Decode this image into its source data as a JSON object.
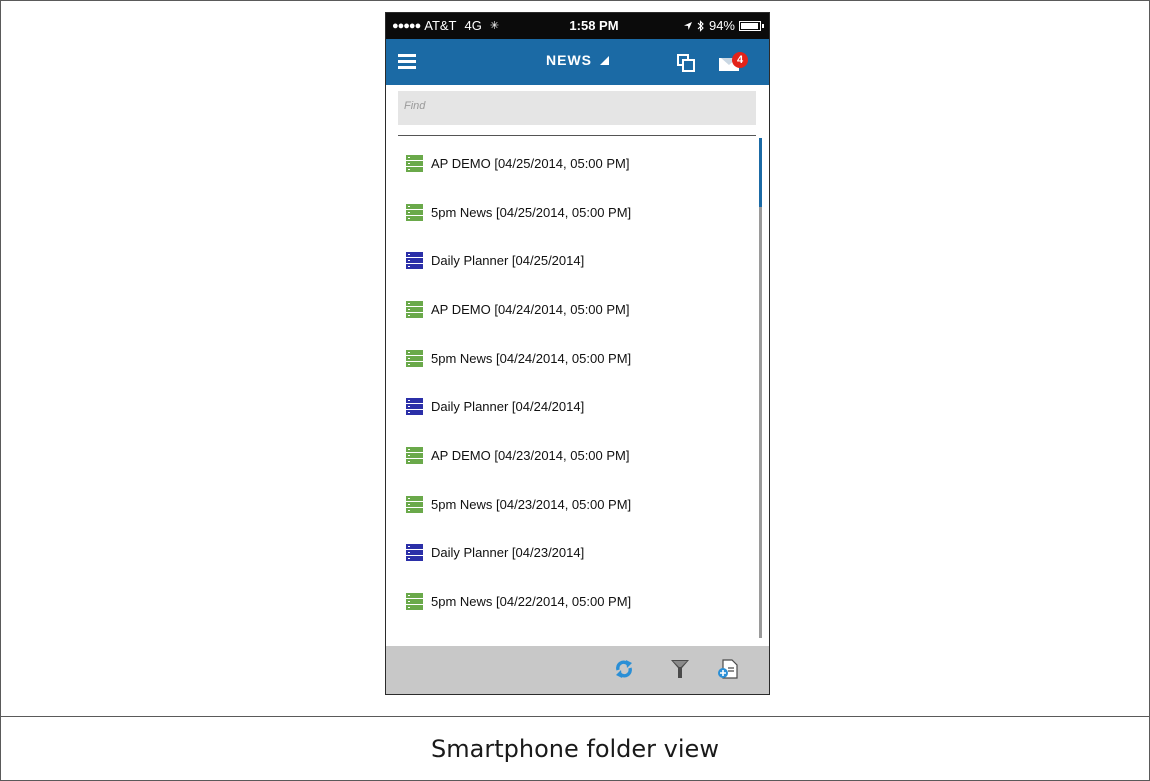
{
  "caption": "Smartphone folder view",
  "status_bar": {
    "signal_dots": "●●●●●",
    "carrier": "AT&T",
    "network": "4G",
    "time": "1:58 PM",
    "battery": "94%"
  },
  "nav": {
    "title": "NEWS",
    "mail_badge_count": "4"
  },
  "search": {
    "placeholder": "Find"
  },
  "items": [
    {
      "label": "AP DEMO [04/25/2014, 05:00 PM]",
      "icon": "green-rundown-icon"
    },
    {
      "label": "5pm News [04/25/2014, 05:00 PM]",
      "icon": "green-rundown-icon"
    },
    {
      "label": "Daily Planner [04/25/2014]",
      "icon": "blue-planner-icon"
    },
    {
      "label": "AP DEMO [04/24/2014, 05:00 PM]",
      "icon": "green-rundown-icon"
    },
    {
      "label": "5pm News [04/24/2014, 05:00 PM]",
      "icon": "green-rundown-icon"
    },
    {
      "label": "Daily Planner [04/24/2014]",
      "icon": "blue-planner-icon"
    },
    {
      "label": "AP DEMO [04/23/2014, 05:00 PM]",
      "icon": "green-rundown-icon"
    },
    {
      "label": "5pm News [04/23/2014, 05:00 PM]",
      "icon": "green-rundown-icon"
    },
    {
      "label": "Daily Planner [04/23/2014]",
      "icon": "blue-planner-icon"
    },
    {
      "label": "5pm News [04/22/2014, 05:00 PM]",
      "icon": "green-rundown-icon"
    }
  ],
  "colors": {
    "nav_blue": "#1b6aa5",
    "badge_red": "#e2231a",
    "rundown_green": "#6aa94a",
    "planner_blue": "#2b2fa8"
  }
}
